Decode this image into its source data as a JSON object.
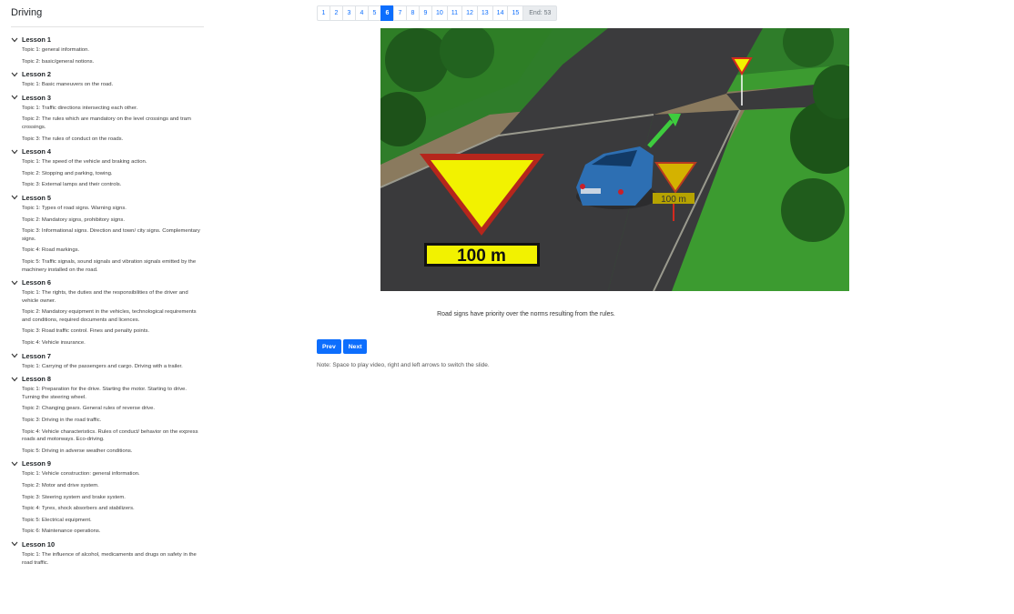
{
  "sidebar": {
    "title": "Driving",
    "lessons": [
      {
        "title": "Lesson 1",
        "topics": [
          "Topic 1: general information.",
          "Topic 2: basic/general notions."
        ]
      },
      {
        "title": "Lesson 2",
        "topics": [
          "Topic 1: Basic maneuvers on the road."
        ]
      },
      {
        "title": "Lesson 3",
        "topics": [
          "Topic 1: Traffic directions intersecting each other.",
          "Topic 2: The rules which are mandatory on the level crossings and tram crossings.",
          "Topic 3: The rules of conduct on the roads."
        ]
      },
      {
        "title": "Lesson 4",
        "topics": [
          "Topic 1: The speed of the vehicle and braking action.",
          "Topic 2: Stopping and parking, towing.",
          "Topic 3: External lamps and their controls."
        ]
      },
      {
        "title": "Lesson 5",
        "topics": [
          "Topic 1: Types of road signs. Warning signs.",
          "Topic 2: Mandatory signs, prohibitory signs.",
          "Topic 3: Informational signs. Direction and town/ city signs. Complementary signs.",
          "Topic 4: Road markings.",
          "Topic 5: Traffic signals, sound signals and vibration signals emitted by the machinery installed on the road."
        ]
      },
      {
        "title": "Lesson 6",
        "topics": [
          "Topic 1: The rights, the duties and the responsibilities of the driver and vehicle owner.",
          "Topic 2: Mandatory equipment in the vehicles, technological requirements and conditions, required documents and licences.",
          "Topic 3: Road traffic control. Fines and penalty points.",
          "Topic 4: Vehicle insurance."
        ]
      },
      {
        "title": "Lesson 7",
        "topics": [
          "Topic 1: Carrying of the passengers and cargo. Driving with a trailer."
        ]
      },
      {
        "title": "Lesson 8",
        "topics": [
          "Topic 1: Preparation for the drive. Starting the motor. Starting to drive. Turning the steering wheel.",
          "Topic 2: Changing gears. General rules of reverse drive.",
          "Topic 3: Driving in the road traffic.",
          "Topic 4: Vehicle characteristics. Rules of conduct/ behavior on the express roads and motorways. Eco-driving.",
          "Topic 5: Driving in adverse weather conditions."
        ]
      },
      {
        "title": "Lesson 9",
        "topics": [
          "Topic 1: Vehicle construction: general information.",
          "Topic 2: Motor and drive system.",
          "Topic 3: Steering system and brake system.",
          "Topic 4: Tyres, shock absorbers and stabilizers.",
          "Topic 5: Electrical equipment.",
          "Topic 6: Maintenance operations."
        ]
      },
      {
        "title": "Lesson 10",
        "topics": [
          "Topic 1: The influence of alcohol, medicaments and drugs on safety in the road traffic."
        ]
      }
    ]
  },
  "pager": {
    "pages": [
      "1",
      "2",
      "3",
      "4",
      "5",
      "6",
      "7",
      "8",
      "9",
      "10",
      "11",
      "12",
      "13",
      "14",
      "15"
    ],
    "active": "6",
    "end_label": "End: 53"
  },
  "slide": {
    "sign_text": "100 m",
    "small_sign_text": "100 m"
  },
  "caption": "Road signs have priority over the norms resulting from the rules.",
  "buttons": {
    "prev": "Prev",
    "next": "Next"
  },
  "note": "Note: Space to play video, right and left arrows to switch the slide.",
  "colors": {
    "accent": "#0d6efd",
    "sign_yellow": "#f2f200",
    "sign_red": "#d42a1e"
  }
}
